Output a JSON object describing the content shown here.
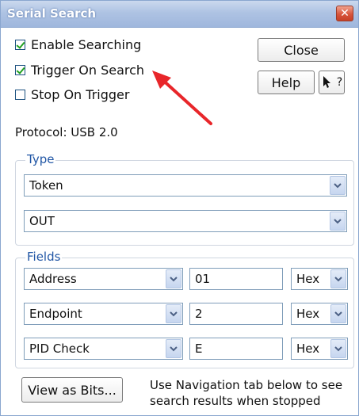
{
  "window": {
    "title": "Serial Search",
    "close_glyph": "✕"
  },
  "options": {
    "enable_searching": {
      "label": "Enable Searching",
      "checked": true
    },
    "trigger_on_search": {
      "label": "Trigger On Search",
      "checked": true
    },
    "stop_on_trigger": {
      "label": "Stop On Trigger",
      "checked": false
    }
  },
  "buttons": {
    "close": "Close",
    "help": "Help",
    "whats_this": "?"
  },
  "protocol": {
    "text": "Protocol: USB 2.0"
  },
  "type_group": {
    "label": "Type",
    "primary_value": "Token",
    "secondary_value": "OUT"
  },
  "fields_group": {
    "label": "Fields",
    "rows": [
      {
        "field": "Address",
        "value": "01",
        "format": "Hex"
      },
      {
        "field": "Endpoint",
        "value": "2",
        "format": "Hex"
      },
      {
        "field": "PID Check",
        "value": "E",
        "format": "Hex"
      }
    ]
  },
  "footer": {
    "view_as_bits": "View as Bits...",
    "note_line1": "Use Navigation tab below to see",
    "note_line2": "search results when stopped"
  },
  "annotation": {
    "arrow_color": "#e8262a"
  },
  "colors": {
    "titlebar": "#aec3e3",
    "group_label": "#2156a5",
    "check_mark": "#21a121"
  }
}
